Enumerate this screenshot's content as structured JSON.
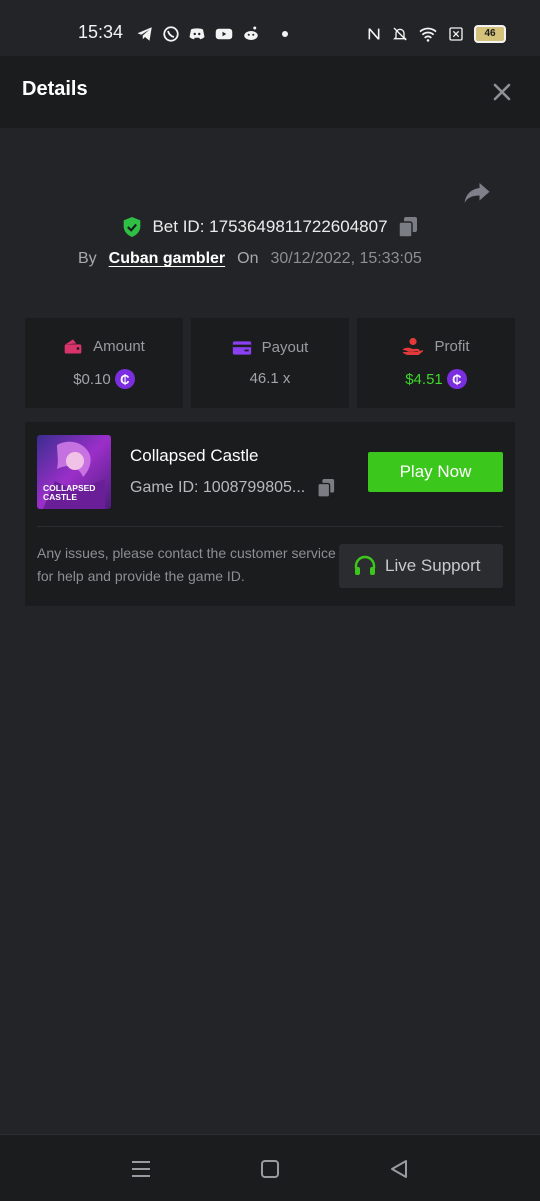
{
  "status_bar": {
    "time": "15:34",
    "battery": "46",
    "left_icons": [
      "telegram-icon",
      "whatsapp-icon",
      "discord-icon",
      "youtube-icon",
      "reddit-icon"
    ],
    "right_icons": [
      "nfc-icon",
      "bell-muted-icon",
      "wifi-icon",
      "no-sim-icon",
      "battery-icon"
    ]
  },
  "header": {
    "title": "Details"
  },
  "bet": {
    "id_text": "Bet ID: 1753649811722604807",
    "by_label": "By",
    "user": "Cuban gambler",
    "on_label": "On",
    "date": "30/12/2022, 15:33:05"
  },
  "stats": {
    "amount": {
      "label": "Amount",
      "value": "$0.10",
      "icon": "amount-icon"
    },
    "payout": {
      "label": "Payout",
      "value": "46.1 x",
      "icon": "card-icon"
    },
    "profit": {
      "label": "Profit",
      "value": "$4.51",
      "icon": "profit-icon"
    },
    "coin_symbol": "₵"
  },
  "game": {
    "name": "Collapsed Castle",
    "id_text": "Game ID: 1008799805...",
    "play_label": "Play Now",
    "thumb_text_1": "COLLAPSED",
    "thumb_text_2": "CASTLE"
  },
  "support": {
    "note": "Any issues, please contact the customer service for help and provide the game ID.",
    "button_label": "Live Support"
  },
  "colors": {
    "accent_green": "#3cc71d",
    "profit_green": "#3ed62a",
    "coin_purple": "#7a2ee0",
    "shield_green": "#2fbf45"
  }
}
